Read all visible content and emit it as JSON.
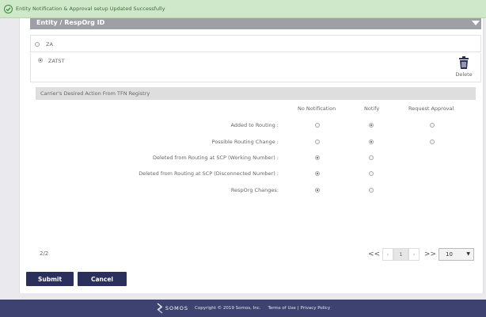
{
  "toast": {
    "message": "Entity Notification & Approval setup Updated Successfully"
  },
  "header": {
    "title": "Entity / RespOrg ID"
  },
  "entities": [
    {
      "name": "ZA",
      "selected": false
    },
    {
      "name": "ZATST",
      "selected": true
    }
  ],
  "delete_label": "Delete",
  "section": {
    "title": "Carrier's Desired Action From TFN Registry"
  },
  "columns": [
    "No Notification",
    "Notify",
    "Request Approval"
  ],
  "rows": [
    {
      "label": "Added to Routing :",
      "options": [
        false,
        true,
        false
      ],
      "available": [
        true,
        true,
        true
      ]
    },
    {
      "label": "Possible Routing Change :",
      "options": [
        false,
        true,
        false
      ],
      "available": [
        true,
        true,
        true
      ]
    },
    {
      "label": "Deleted from Routing at SCP (Working Number) :",
      "options": [
        true,
        false,
        false
      ],
      "available": [
        true,
        true,
        false
      ]
    },
    {
      "label": "Deleted from Routing at SCP (Disconnected Number) :",
      "options": [
        true,
        false,
        false
      ],
      "available": [
        true,
        true,
        false
      ]
    },
    {
      "label": "RespOrg Changes:",
      "options": [
        true,
        false,
        false
      ],
      "available": [
        true,
        true,
        false
      ]
    }
  ],
  "pagination": {
    "info": "2/2",
    "first": "<<",
    "prev": "‹",
    "current": "1",
    "next": "›",
    "last": ">>",
    "page_size": "10"
  },
  "buttons": {
    "submit": "Submit",
    "cancel": "Cancel"
  },
  "footer": {
    "brand": "SOMOS",
    "copyright": "Copyright © 2019 Somos, Inc.",
    "terms": "Terms of Use",
    "separator": "|",
    "privacy": "Privacy Policy"
  },
  "colors": {
    "accent": "#2b2f5b",
    "footer": "#3e4270",
    "toast_bg": "#cfe8c9",
    "header_bg": "#9fa0a6"
  }
}
